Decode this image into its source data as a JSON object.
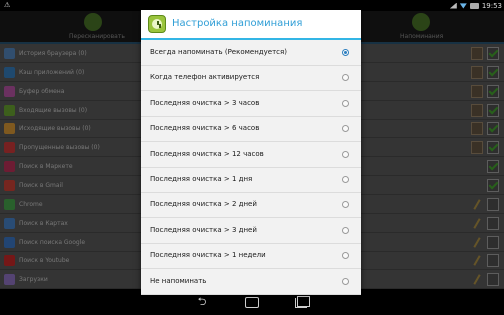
{
  "status_bar": {
    "time": "19:53"
  },
  "app_tabs": [
    {
      "label": "Пересканировать",
      "icon": "search-icon"
    },
    {
      "label": "Напоминания",
      "icon": "clock-icon"
    }
  ],
  "list_items": [
    {
      "label": "История браузера (0)",
      "icon": "globe-icon",
      "icon_color": "#5a8ec9",
      "action": "clip",
      "checked": true
    },
    {
      "label": "Кэш приложений (0)",
      "icon": "cache-icon",
      "icon_color": "#3a86c8",
      "action": "clip",
      "checked": true
    },
    {
      "label": "Буфер обмена",
      "icon": "clipboard-icon",
      "icon_color": "#c45ab0",
      "action": "clip",
      "checked": true
    },
    {
      "label": "Входящие вызовы (0)",
      "icon": "incoming-call-icon",
      "icon_color": "#6fae33",
      "action": "clip",
      "checked": true
    },
    {
      "label": "Исходящие вызовы (0)",
      "icon": "outgoing-call-icon",
      "icon_color": "#e8a23a",
      "action": "clip",
      "checked": true
    },
    {
      "label": "Пропущенные вызовы (0)",
      "icon": "missed-call-icon",
      "icon_color": "#d93c3c",
      "action": "clip",
      "checked": true
    },
    {
      "label": "Поиск в Маркете",
      "icon": "market-icon",
      "icon_color": "#c7345d",
      "action": "none",
      "checked": true
    },
    {
      "label": "Поиск в Gmail",
      "icon": "gmail-icon",
      "icon_color": "#d8453a",
      "action": "none",
      "checked": true
    },
    {
      "label": "Chrome",
      "icon": "chrome-icon",
      "icon_color": "#4caf50",
      "action": "broom",
      "checked": false
    },
    {
      "label": "Поиск в Картах",
      "icon": "maps-icon",
      "icon_color": "#4b8ad6",
      "action": "broom",
      "checked": false
    },
    {
      "label": "Поиск поиска Google",
      "icon": "google-search-icon",
      "icon_color": "#3f7fd2",
      "action": "broom",
      "checked": false
    },
    {
      "label": "Поиск в Youtube",
      "icon": "youtube-icon",
      "icon_color": "#d62b2b",
      "action": "broom",
      "checked": false
    },
    {
      "label": "Загрузки",
      "icon": "downloads-icon",
      "icon_color": "#9a7bd0",
      "action": "broom",
      "checked": false
    }
  ],
  "dialog": {
    "title": "Настройка напоминания",
    "icon": "clock-icon",
    "options": [
      {
        "label": "Всегда напоминать (Рекомендуется)",
        "selected": true
      },
      {
        "label": "Когда телефон активируется",
        "selected": false
      },
      {
        "label": "Последняя очистка > 3 часов",
        "selected": false
      },
      {
        "label": "Последняя очистка > 6 часов",
        "selected": false
      },
      {
        "label": "Последняя очистка > 12 часов",
        "selected": false
      },
      {
        "label": "Последняя очистка > 1 дня",
        "selected": false
      },
      {
        "label": "Последняя очистка > 2 дней",
        "selected": false
      },
      {
        "label": "Последняя очистка > 3 дней",
        "selected": false
      },
      {
        "label": "Последняя очистка > 1 недели",
        "selected": false
      },
      {
        "label": "Не напоминать",
        "selected": false
      }
    ]
  },
  "colors": {
    "accent": "#33b5e5",
    "title": "#2f9ed6",
    "radio_selected": "#2e7fbf",
    "check": "#4ab032"
  },
  "nav_bar": {
    "buttons": [
      "back-icon",
      "home-icon",
      "recent-apps-icon"
    ]
  }
}
